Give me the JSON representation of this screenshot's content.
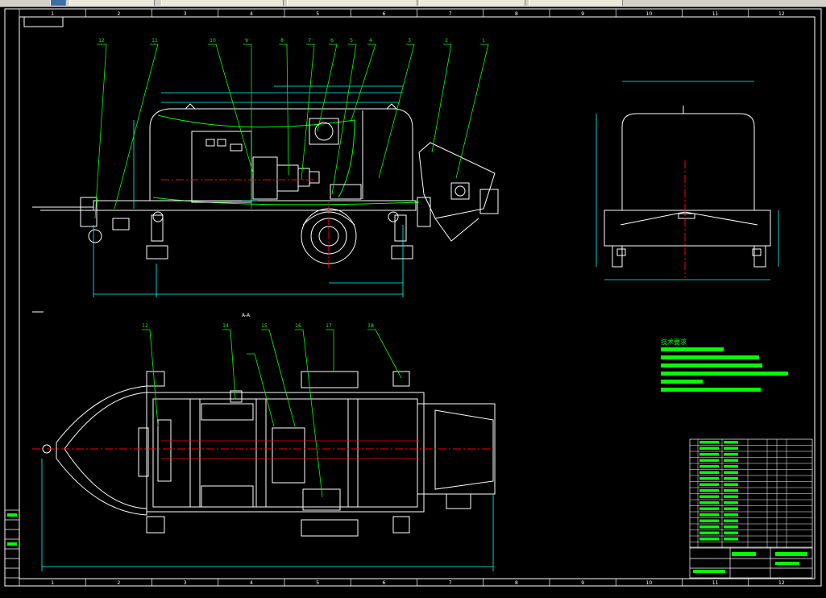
{
  "app": {
    "colors": {
      "background": "#000000",
      "frame": "#ffffff",
      "leader": "#00ff00",
      "center_line": "#ff0000",
      "dimension": "#00ffff",
      "notes": "#00ff00"
    }
  },
  "drawing": {
    "columns": [
      "1",
      "2",
      "3",
      "4",
      "5",
      "6",
      "7",
      "8",
      "9",
      "10",
      "11",
      "12"
    ],
    "callouts_top": [
      "12",
      "11",
      "10",
      "9",
      "8",
      "7",
      "6",
      "5",
      "4",
      "3",
      "2",
      "1"
    ],
    "callouts_bottom": [
      "12",
      "14",
      "15",
      "16",
      "17",
      "18"
    ],
    "section_label": "A-A",
    "tech_notes_title": "技术要求"
  }
}
